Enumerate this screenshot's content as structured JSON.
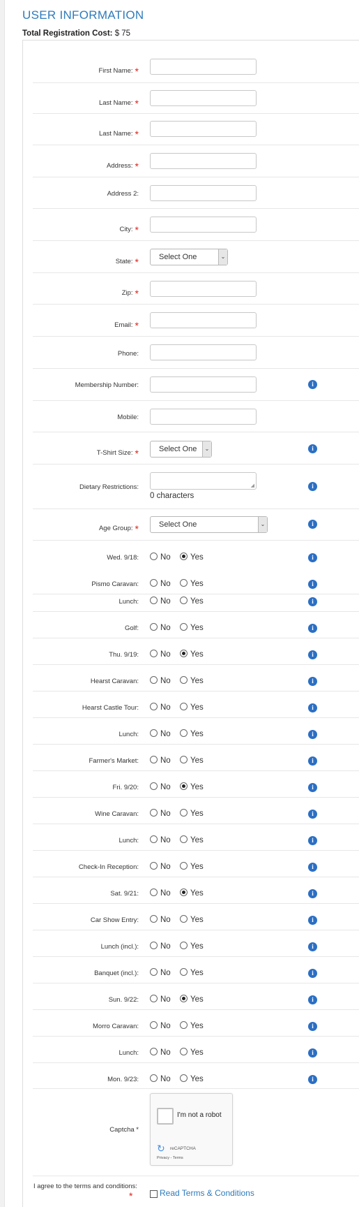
{
  "header": {
    "title": "USER INFORMATION",
    "cost_label": "Total Registration Cost:",
    "cost_value": "$ 75"
  },
  "fields": {
    "first_name": "First Name:",
    "last_name_1": "Last Name:",
    "last_name_2": "Last Name:",
    "address": "Address:",
    "address2": "Address 2:",
    "city": "City:",
    "state": "State:",
    "state_value": "Select One",
    "zip": "Zip:",
    "email": "Email:",
    "phone": "Phone:",
    "membership": "Membership Number:",
    "mobile": "Mobile:",
    "tshirt": "T-Shirt Size:",
    "tshirt_value": "Select One",
    "dietary": "Dietary Restrictions:",
    "dietary_count": "0 characters",
    "age_group": "Age Group:",
    "age_group_value": "Select One"
  },
  "radio_no": "No",
  "radio_yes": "Yes",
  "events": [
    {
      "label": "Wed. 9/18:",
      "selected": "Yes"
    },
    {
      "label": "Pismo Caravan:",
      "selected": null
    },
    {
      "label": "Lunch:",
      "selected": null
    },
    {
      "label": "Golf:",
      "selected": null
    },
    {
      "label": "Thu. 9/19:",
      "selected": "Yes"
    },
    {
      "label": "Hearst Caravan:",
      "selected": null
    },
    {
      "label": "Hearst Castle Tour:",
      "selected": null
    },
    {
      "label": "Lunch:",
      "selected": null
    },
    {
      "label": "Farmer's Market:",
      "selected": null
    },
    {
      "label": "Fri. 9/20:",
      "selected": "Yes"
    },
    {
      "label": "Wine Caravan:",
      "selected": null
    },
    {
      "label": "Lunch:",
      "selected": null
    },
    {
      "label": "Check-In Reception:",
      "selected": null
    },
    {
      "label": "Sat. 9/21:",
      "selected": "Yes"
    },
    {
      "label": "Car Show Entry:",
      "selected": null
    },
    {
      "label": "Lunch (incl.):",
      "selected": null
    },
    {
      "label": "Banquet (incl.):",
      "selected": null
    },
    {
      "label": "Sun. 9/22:",
      "selected": "Yes"
    },
    {
      "label": "Morro Caravan:",
      "selected": null
    },
    {
      "label": "Lunch:",
      "selected": null
    },
    {
      "label": "Mon. 9/23:",
      "selected": null
    }
  ],
  "captcha": {
    "label": "Captcha *",
    "checkbox_text": "I'm not a robot",
    "brand": "reCAPTCHA",
    "links": "Privacy - Terms"
  },
  "terms": {
    "label": "I agree to the terms and conditions:",
    "required": "*",
    "link": "Read Terms & Conditions"
  },
  "icons": {
    "info": "info-icon",
    "required": "*"
  }
}
